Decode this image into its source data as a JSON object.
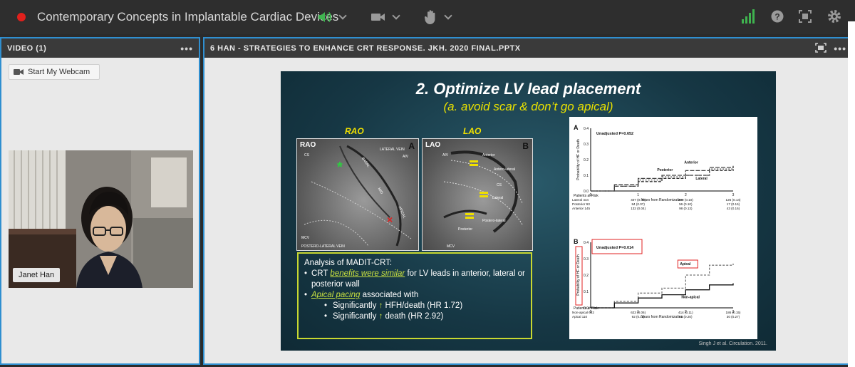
{
  "topbar": {
    "title": "Contemporary Concepts in Implantable Cardiac Devices"
  },
  "video_pod": {
    "header": "VIDEO (1)",
    "more": "•••",
    "webcam_button": "Start My Webcam",
    "participant_name": "Janet Han"
  },
  "share_pod": {
    "header": "6 HAN - STRATEGIES TO ENHANCE CRT RESPONSE. JKH. 2020 FINAL.PPTX",
    "more": "•••"
  },
  "slide": {
    "title": "2. Optimize LV lead placement",
    "subtitle": "(a. avoid scar & don’t go apical)",
    "rao_label": "RAO",
    "lao_label": "LAO",
    "panel_a": {
      "tag": "RAO",
      "letter": "A",
      "labels": [
        "CS",
        "BASAL",
        "LATERAL VEIN",
        "AIV",
        "MID",
        "APICAL",
        "MCV",
        "POSTERO-LATERAL VEIN"
      ]
    },
    "panel_b": {
      "tag": "LAO",
      "letter": "B",
      "labels": [
        "AIV",
        "Anterior",
        "Antero-lateral",
        "CS",
        "Lateral",
        "Postero-lateral",
        "Posterior",
        "MCV"
      ]
    },
    "analysis": {
      "heading": "Analysis of MADIT-CRT:",
      "b1_pre": "CRT ",
      "b1_hl": "benefits were similar",
      "b1_post": " for LV leads in anterior, lateral or posterior wall",
      "b2_hl": "Apical pacing",
      "b2_post": " associated with",
      "s1_pre": "Significantly ",
      "s1_arrow": "↑",
      "s1_post": " HFH/death (HR 1.72)",
      "s2_pre": "Significantly ",
      "s2_arrow": "↑",
      "s2_post": " death (HR 2.92)"
    },
    "citation": "Singh J et al. Circulation. 2011."
  },
  "chart_data": [
    {
      "type": "line",
      "panel": "A",
      "annotation": "Unadjusted P=0.652",
      "xlabel": "Years from Randomization",
      "ylabel": "Probability of HF or Death",
      "xlim": [
        0,
        3
      ],
      "ylim": [
        0,
        0.4
      ],
      "xticks": [
        "0",
        "1",
        "2",
        "3"
      ],
      "yticks": [
        "0.0",
        "0.1",
        "0.2",
        "0.3",
        "0.4"
      ],
      "series": [
        {
          "name": "Lateral",
          "x": [
            0,
            0.5,
            1,
            1.5,
            2,
            2.5,
            3
          ],
          "y": [
            0,
            0.03,
            0.06,
            0.08,
            0.1,
            0.13,
            0.14
          ]
        },
        {
          "name": "Posterior",
          "x": [
            0,
            0.5,
            1,
            1.5,
            2,
            2.5,
            3
          ],
          "y": [
            0,
            0.03,
            0.07,
            0.09,
            0.1,
            0.14,
            0.16
          ]
        },
        {
          "name": "Anterior",
          "x": [
            0,
            0.5,
            1,
            1.5,
            2,
            2.5,
            3
          ],
          "y": [
            0,
            0.04,
            0.08,
            0.1,
            0.13,
            0.15,
            0.16
          ]
        }
      ],
      "risk_table": {
        "title": "Patients at Risk",
        "rows": [
          {
            "label": "Lateral 444",
            "vals": [
              "407 (0.06)",
              "260 (0.10)",
              "126 (0.14)"
            ]
          },
          {
            "label": "Posterior 93",
            "vals": [
              "84 (0.07)",
              "56 (0.10)",
              "17 (0.16)"
            ]
          },
          {
            "label": "Anterior 145",
            "vals": [
              "132 (0.04)",
              "98 (0.13)",
              "43 (0.16)"
            ]
          }
        ]
      }
    },
    {
      "type": "line",
      "panel": "B",
      "annotation": "Unadjusted P=0.014",
      "xlabel": "Years from Randomization",
      "ylabel": "Probability of HF or Death",
      "xlim": [
        0,
        3
      ],
      "ylim": [
        0,
        0.4
      ],
      "xticks": [
        "0",
        "1",
        "2",
        "3"
      ],
      "yticks": [
        "0.0",
        "0.1",
        "0.2",
        "0.3",
        "0.4"
      ],
      "series": [
        {
          "name": "Apical",
          "x": [
            0,
            0.5,
            1,
            1.5,
            2,
            2.5,
            3
          ],
          "y": [
            0,
            0.04,
            0.09,
            0.12,
            0.2,
            0.26,
            0.27
          ]
        },
        {
          "name": "Non-apical",
          "x": [
            0,
            0.5,
            1,
            1.5,
            2,
            2.5,
            3
          ],
          "y": [
            0,
            0.03,
            0.06,
            0.08,
            0.11,
            0.14,
            0.15
          ]
        }
      ],
      "risk_table": {
        "title": "Patients at Risk",
        "rows": [
          {
            "label": "Non-apical 682",
            "vals": [
              "623 (0.06)",
              "414 (0.11)",
              "186 (0.15)"
            ]
          },
          {
            "label": "Apical 110",
            "vals": [
              "92 (0.11)",
              "61 (0.20)",
              "30 (0.27)"
            ]
          }
        ]
      }
    }
  ]
}
